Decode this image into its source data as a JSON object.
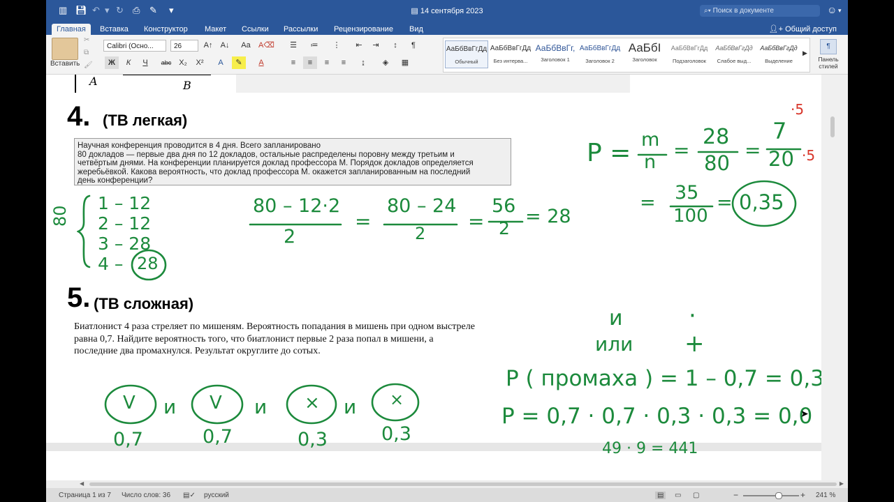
{
  "window": {
    "title": "14 сентября 2023"
  },
  "search": {
    "placeholder": "Поиск в документе"
  },
  "tabs": [
    "Главная",
    "Вставка",
    "Конструктор",
    "Макет",
    "Ссылки",
    "Рассылки",
    "Рецензирование",
    "Вид"
  ],
  "share_label": "Общий доступ",
  "ribbon": {
    "paste_label": "Вставить",
    "font_name": "Calibri (Осно...",
    "font_size": "26",
    "bold": "Ж",
    "italic": "К",
    "underline": "Ч",
    "strike": "abc",
    "subscript": "X₂",
    "superscript": "X²",
    "styles": [
      {
        "preview": "АаБбВвГгДд",
        "name": "Обычный"
      },
      {
        "preview": "АаБбВвГгДд",
        "name": "Без интерва..."
      },
      {
        "preview": "АаБбВвГг,",
        "name": "Заголовок 1"
      },
      {
        "preview": "АаБбВвГгДд",
        "name": "Заголовок 2"
      },
      {
        "preview": "АаБбI",
        "name": "Заголовок"
      },
      {
        "preview": "АаБбВвГгДд",
        "name": "Подзаголовок"
      },
      {
        "preview": "АаБбВвГгДд",
        "name": "Слабое выд..."
      },
      {
        "preview": "АаБбВвГгДд",
        "name": "Выделение"
      }
    ],
    "styles_pane_label": "Панель стилей"
  },
  "document": {
    "fig_label_a": "A",
    "fig_label_b": "B",
    "task4_number": "4.",
    "task4_title": "(ТВ легкая)",
    "task4_text_1": "Научная конференция проводится в 4 дня. Всего запланировано",
    "task4_text_2": "80 докладов — первые два дня по 12 докладов, остальные распределены поровну между третьим и",
    "task4_text_3": "четвёртым днями. На конференции планируется доклад профессора М. Порядок докладов определяется",
    "task4_text_4": "жеребьёвкой. Какова вероятность, что доклад профессора М. окажется запланированным на последний",
    "task4_text_5": "день конференции?",
    "task5_number": "5.",
    "task5_title": "(ТВ сложная)",
    "task5_text_1": "Биатлонист 4 раза стреляет по мишеням. Вероятность попадания в мишень при одном выстреле",
    "task5_text_2": "равна 0,7. Найдите вероятность того, что биатлонист первые 2 раза попал в мишени, а",
    "task5_text_3": "последние два промахнулся. Результат округлите до сотых."
  },
  "handwriting": {
    "days_total": "80",
    "day1": "1 – 12",
    "day2": "2 – 12",
    "day3": "3 – 28",
    "day4": "4 –",
    "day4_circled": "28",
    "calc_num1": "80 – 12·2",
    "calc_den1": "2",
    "eq1": "=",
    "calc_num2": "80 – 24",
    "calc_den2": "2",
    "eq2": "=",
    "calc_num3": "56",
    "calc_den3": "2",
    "calc_result": "= 28",
    "p_label": "P =",
    "m": "m",
    "n": "n",
    "eq3": "=",
    "num_28": "28",
    "den_80": "80",
    "eq4": "=",
    "num_7": "7",
    "den_20": "20",
    "mult5_top": "·5",
    "mult5_bottom": "·5",
    "eq5": "=",
    "num_35": "35",
    "den_100": "100",
    "eq6": "=",
    "answer": "0,35",
    "and_word": "и",
    "or_word": "или",
    "dot_sign": "·",
    "plus_sign": "+",
    "shots": [
      "V",
      "V",
      "×",
      "×"
    ],
    "shot_probs": [
      "0,7",
      "0,7",
      "0,3",
      "0,3"
    ],
    "conj": [
      "и",
      "и",
      "и"
    ],
    "p_miss": "P ( промаха ) = 1 – 0,7 = 0,3",
    "p_total": "P = 0,7 · 0,7 · 0,3 · 0,3 = 0,0",
    "product_line": "49   ·   9   =   441"
  },
  "status": {
    "page": "Страница 1 из 7",
    "words": "Число слов: 36",
    "language": "русский",
    "zoom": "241 %"
  }
}
